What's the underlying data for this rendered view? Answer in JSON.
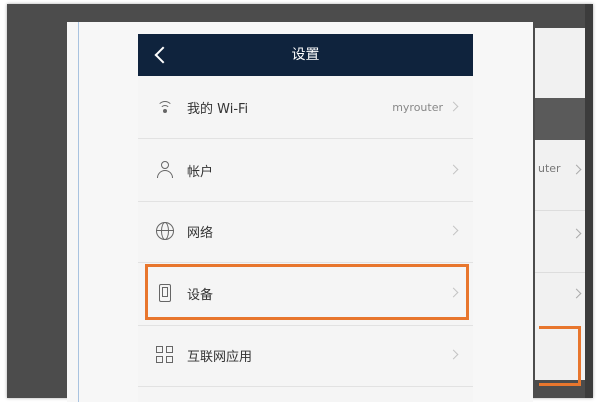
{
  "header": {
    "title": "设置"
  },
  "items": [
    {
      "label": "我的 Wi-Fi",
      "value": "myrouter",
      "icon": "wifi-icon"
    },
    {
      "label": "帐户",
      "value": "",
      "icon": "user-icon"
    },
    {
      "label": "网络",
      "value": "",
      "icon": "globe-icon"
    },
    {
      "label": "设备",
      "value": "",
      "icon": "device-icon"
    },
    {
      "label": "互联网应用",
      "value": "",
      "icon": "apps-grid-icon"
    }
  ],
  "background_app": {
    "partial_text": "uter"
  },
  "colors": {
    "header_bg": "#0f233d",
    "highlight": "#e8762d",
    "screen_bg": "#f5f5f5"
  }
}
